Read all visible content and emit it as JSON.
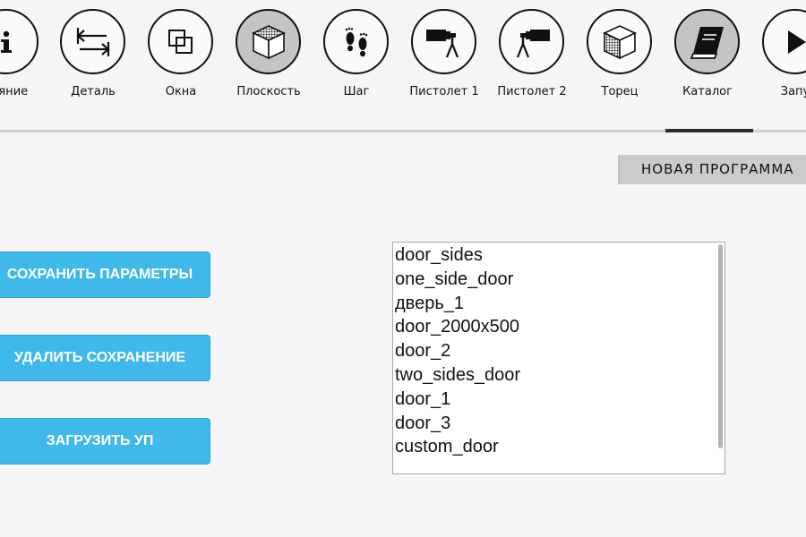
{
  "toolbar": {
    "items": [
      {
        "label": "тояние",
        "icon": "info-icon"
      },
      {
        "label": "Деталь",
        "icon": "detail-arrows-icon"
      },
      {
        "label": "Окна",
        "icon": "windows-icon"
      },
      {
        "label": "Плоскость",
        "icon": "plane-cube-icon"
      },
      {
        "label": "Шаг",
        "icon": "footprints-icon"
      },
      {
        "label": "Пистолет 1",
        "icon": "gun-1-icon"
      },
      {
        "label": "Пистолет 2",
        "icon": "gun-2-icon"
      },
      {
        "label": "Торец",
        "icon": "end-cube-icon"
      },
      {
        "label": "Каталог",
        "icon": "catalog-book-icon"
      },
      {
        "label": "Запу",
        "icon": "play-icon"
      }
    ]
  },
  "new_program_label": "НОВАЯ ПРОГРАММА",
  "actions": {
    "save_label": "СОХРАНИТЬ ПАРАМЕТРЫ",
    "delete_label": "УДАЛИТЬ СОХРАНЕНИЕ",
    "load_label": "ЗАГРУЗИТЬ УП"
  },
  "programs": [
    "door_sides",
    "one_side_door",
    "дверь_1",
    "door_2000x500",
    "door_2",
    "two_sides_door",
    "door_1",
    "door_3",
    "custom_door"
  ],
  "colors": {
    "button": "#3fb8ea",
    "active_tool": "#c4c4c4",
    "tab": "#cbcbcb"
  }
}
